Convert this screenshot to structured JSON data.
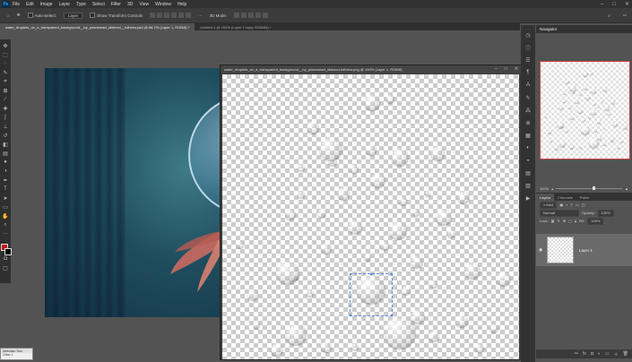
{
  "menubar": {
    "logo": "Ps",
    "items": [
      "File",
      "Edit",
      "Image",
      "Layer",
      "Type",
      "Select",
      "Filter",
      "3D",
      "View",
      "Window",
      "Help"
    ],
    "window_controls": [
      "–",
      "□",
      "✕"
    ]
  },
  "optionsbar": {
    "auto_select_label": "Auto-Select:",
    "auto_select_value": "Layer",
    "transform_label": "Show Transform Controls",
    "mode_3d": "3D Mode:"
  },
  "tabs": [
    {
      "label": "water_droplets_on_a_transparent_background__by_pearsoeart_distenci__fullview.psd @ 66.7% (Layer 1, RGB/8) *",
      "active": true
    },
    {
      "label": "Untitled-1 @ 100% (Layer 1 copy, RGB/8#) *",
      "active": false
    }
  ],
  "doc2": {
    "title": "water_droplets_on_a_transparent_background__by_pearsoeart_distanci-fullview.png @ 100% (Layer 1, RGB/8)",
    "controls": [
      "–",
      "□",
      "✕"
    ]
  },
  "navigator": {
    "title": "Navigator",
    "zoom": "100%"
  },
  "layers": {
    "tabs": [
      "Layers",
      "Channels",
      "Paths"
    ],
    "kind_label": "Kind",
    "blend_mode": "Normal",
    "opacity_label": "Opacity:",
    "opacity_value": "100%",
    "lock_label": "Lock:",
    "fill_label": "Fill:",
    "fill_value": "100%",
    "layer_name": "Layer 1"
  },
  "selection_window": {
    "title": "Selection Tool",
    "value": "Other 1"
  },
  "icons": {
    "tools": [
      "move-icon",
      "marquee-icon",
      "lasso-icon",
      "quick-select-icon",
      "crop-icon",
      "frame-icon",
      "eyedropper-icon",
      "healing-icon",
      "brush-icon",
      "stamp-icon",
      "history-brush-icon",
      "eraser-icon",
      "gradient-icon",
      "blur-icon",
      "dodge-icon",
      "pen-icon",
      "type-icon",
      "path-select-icon",
      "rectangle-icon",
      "hand-icon",
      "zoom-icon",
      "more-icon"
    ]
  }
}
